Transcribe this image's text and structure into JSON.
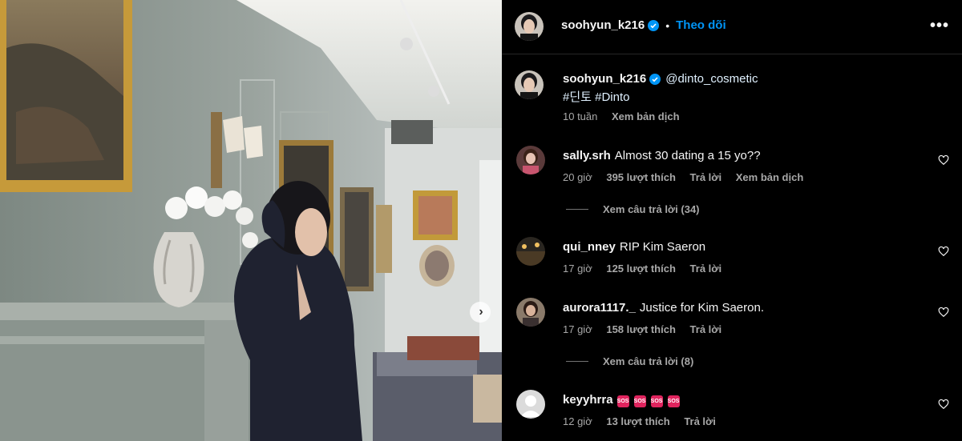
{
  "colors": {
    "accent": "#0095f6",
    "background": "#000000",
    "muted": "#a8a8a8",
    "verified": "#0095f6"
  },
  "header": {
    "username": "soohyun_k216",
    "separator": "•",
    "follow_label": "Theo dõi",
    "more_label": "•••",
    "verified_icon": "verified-badge-icon"
  },
  "caption": {
    "username": "soohyun_k216",
    "mention": "@dinto_cosmetic",
    "hashtags": "#딘토 #Dinto",
    "time": "10 tuần",
    "translate_label": "Xem bản dịch"
  },
  "carousel": {
    "next_label": "›"
  },
  "comments": [
    {
      "username": "sally.srh",
      "text": "Almost 30 dating a 15 yo??",
      "time": "20 giờ",
      "likes": "395 lượt thích",
      "reply_label": "Trả lời",
      "translate_label": "Xem bản dịch",
      "replies_label": "Xem câu trả lời (34)"
    },
    {
      "username": "qui_nney",
      "text": "RIP Kim Saeron",
      "time": "17 giờ",
      "likes": "125 lượt thích",
      "reply_label": "Trả lời"
    },
    {
      "username": "aurora1117._",
      "text": "Justice for Kim Saeron.",
      "time": "17 giờ",
      "likes": "158 lượt thích",
      "reply_label": "Trả lời",
      "replies_label": "Xem câu trả lời (8)"
    },
    {
      "username": "keyyhrra",
      "emoji": [
        "SOS",
        "SOS",
        "SOS",
        "SOS"
      ],
      "time": "12 giờ",
      "likes": "13 lượt thích",
      "reply_label": "Trả lời"
    }
  ]
}
